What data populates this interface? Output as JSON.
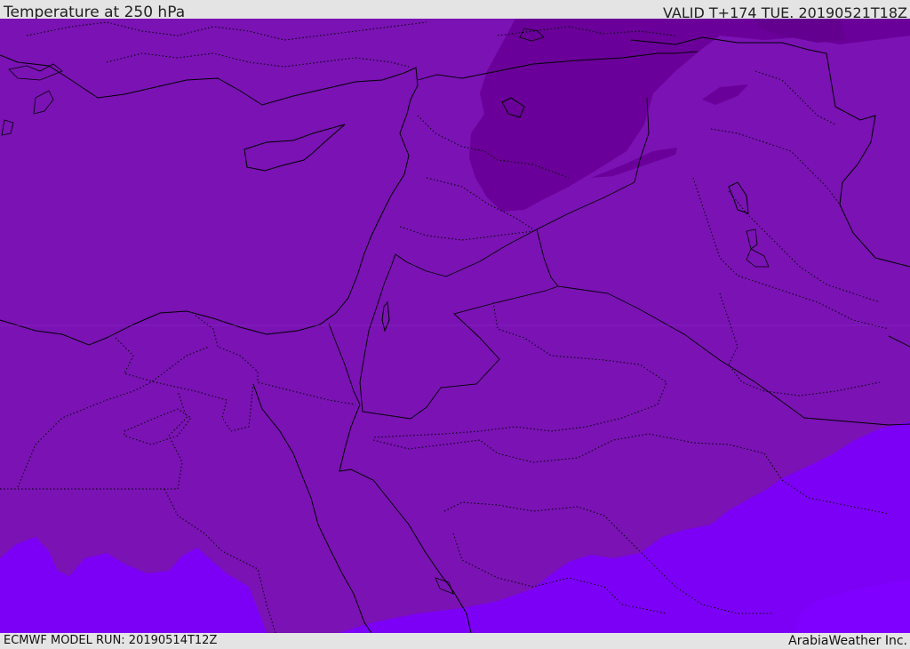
{
  "header": {
    "title": "Temperature at 250 hPa",
    "valid_time": "VALID T+174 TUE. 20190521T18Z"
  },
  "footer": {
    "model_run": "ECMWF MODEL RUN: 20190514T12Z",
    "credit": "ArabiaWeather Inc."
  },
  "map": {
    "fill_colors": {
      "main": "#7a12b4",
      "cold": "#6a0099",
      "warm": "#7d00f6",
      "warmest": "#7f00ff",
      "border": "#000000"
    }
  }
}
